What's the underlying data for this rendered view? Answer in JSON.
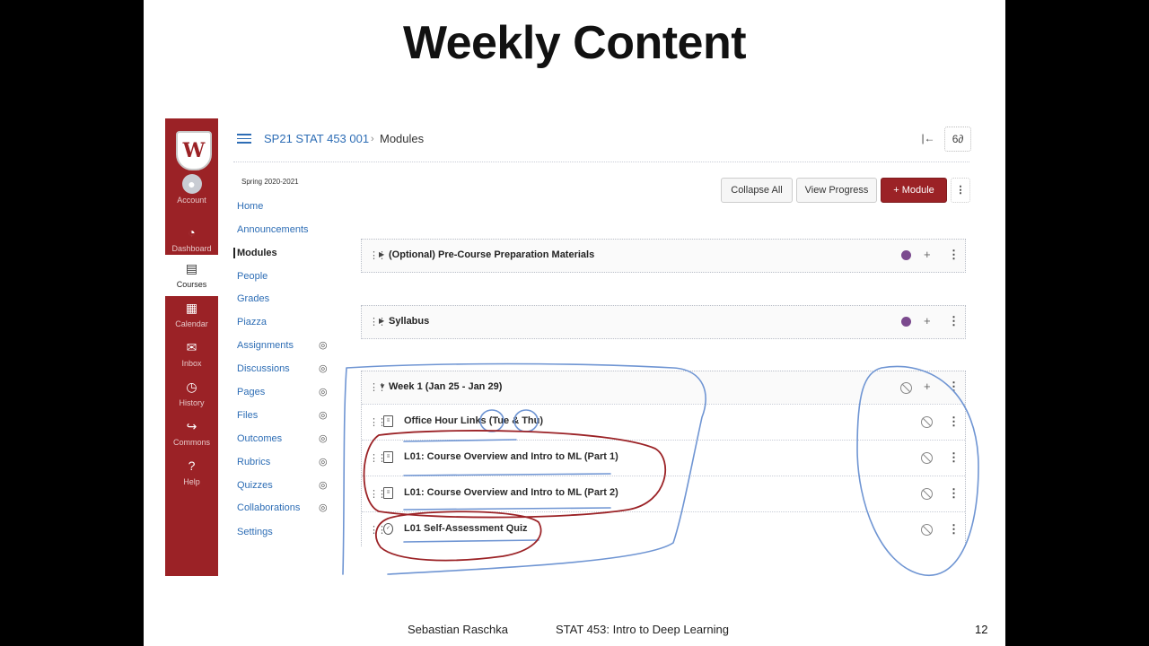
{
  "slide": {
    "title": "Weekly Content",
    "footer_author": "Sebastian Raschka",
    "footer_course": "STAT 453: Intro to Deep Learning",
    "page_number": "12"
  },
  "global_nav": {
    "logo": "W",
    "items": [
      {
        "label": "Account",
        "icon": "account-icon"
      },
      {
        "label": "Dashboard",
        "icon": "dashboard-icon"
      },
      {
        "label": "Courses",
        "icon": "courses-icon"
      },
      {
        "label": "Calendar",
        "icon": "calendar-icon"
      },
      {
        "label": "Inbox",
        "icon": "inbox-icon"
      },
      {
        "label": "History",
        "icon": "history-icon"
      },
      {
        "label": "Commons",
        "icon": "commons-icon"
      },
      {
        "label": "Help",
        "icon": "help-icon"
      }
    ],
    "accent": "#9b2226"
  },
  "header": {
    "course": "SP21 STAT 453 001",
    "separator": "›",
    "page": "Modules",
    "btn_collapse_nav": "|←",
    "btn_immersive": "6∂"
  },
  "course_nav": {
    "term": "Spring 2020-2021",
    "items": [
      {
        "label": "Home"
      },
      {
        "label": "Announcements"
      },
      {
        "label": "Modules"
      },
      {
        "label": "People"
      },
      {
        "label": "Grades"
      },
      {
        "label": "Piazza"
      },
      {
        "label": "Assignments"
      },
      {
        "label": "Discussions"
      },
      {
        "label": "Pages"
      },
      {
        "label": "Files"
      },
      {
        "label": "Outcomes"
      },
      {
        "label": "Rubrics"
      },
      {
        "label": "Quizzes"
      },
      {
        "label": "Collaborations"
      },
      {
        "label": "Settings"
      }
    ]
  },
  "toolbar": {
    "collapse_all": "Collapse All",
    "view_progress": "View Progress",
    "add_module": "+ Module"
  },
  "modules": [
    {
      "title": "(Optional) Pre-Course Preparation Materials",
      "published": true
    },
    {
      "title": "Syllabus",
      "published": true
    },
    {
      "title": "Week 1 (Jan 25 - Jan 29)",
      "published": false,
      "items": [
        {
          "title": "Office Hour Links (Tue & Thu)"
        },
        {
          "title": "L01: Course Overview and Intro to ML (Part 1)"
        },
        {
          "title": "L01: Course Overview and Intro to ML (Part 2)"
        },
        {
          "title": "L01 Self-Assessment Quiz"
        }
      ]
    }
  ]
}
